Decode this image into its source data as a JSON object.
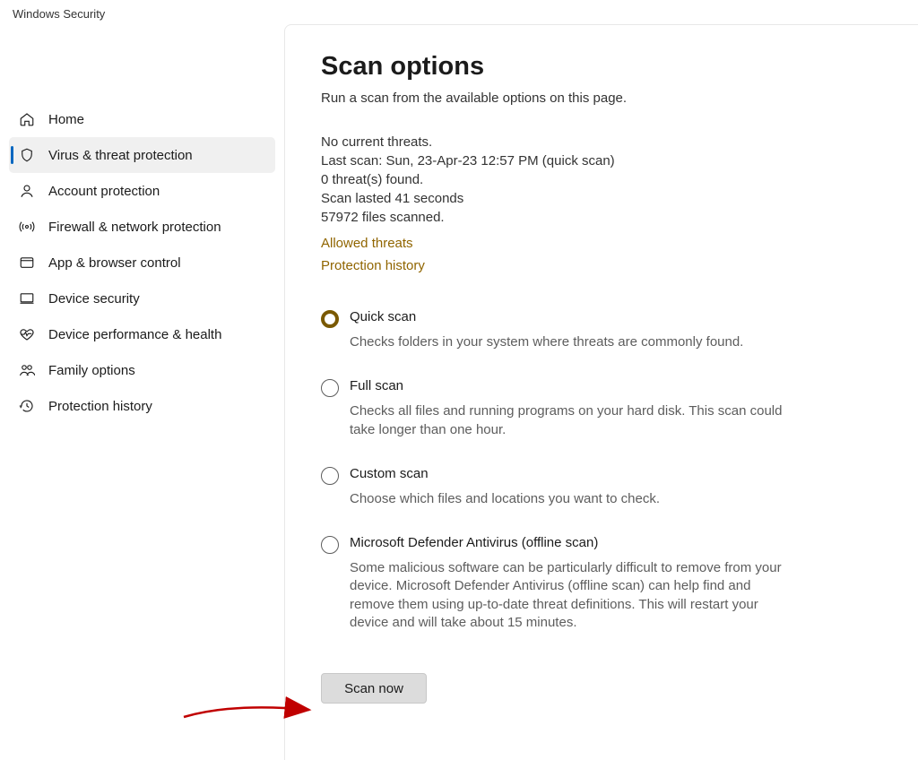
{
  "window": {
    "title": "Windows Security"
  },
  "sidebar": {
    "items": [
      {
        "label": "Home",
        "icon": "home-icon"
      },
      {
        "label": "Virus & threat protection",
        "icon": "shield-icon",
        "selected": true
      },
      {
        "label": "Account protection",
        "icon": "person-icon"
      },
      {
        "label": "Firewall & network protection",
        "icon": "antenna-icon"
      },
      {
        "label": "App & browser control",
        "icon": "browser-icon"
      },
      {
        "label": "Device security",
        "icon": "device-icon"
      },
      {
        "label": "Device performance & health",
        "icon": "heart-icon"
      },
      {
        "label": "Family options",
        "icon": "family-icon"
      },
      {
        "label": "Protection history",
        "icon": "history-icon"
      }
    ]
  },
  "main": {
    "title": "Scan options",
    "subtitle": "Run a scan from the available options on this page.",
    "status": {
      "threats": "No current threats.",
      "last_scan": "Last scan: Sun, 23-Apr-23 12:57 PM (quick scan)",
      "found": "0 threat(s) found.",
      "duration": "Scan lasted 41 seconds",
      "files": "57972 files scanned."
    },
    "links": {
      "allowed": "Allowed threats",
      "history": "Protection history"
    },
    "options": [
      {
        "key": "quick",
        "title": "Quick scan",
        "desc": "Checks folders in your system where threats are commonly found.",
        "checked": true
      },
      {
        "key": "full",
        "title": "Full scan",
        "desc": "Checks all files and running programs on your hard disk. This scan could take longer than one hour.",
        "checked": false
      },
      {
        "key": "custom",
        "title": "Custom scan",
        "desc": "Choose which files and locations you want to check.",
        "checked": false
      },
      {
        "key": "offline",
        "title": "Microsoft Defender Antivirus (offline scan)",
        "desc": "Some malicious software can be particularly difficult to remove from your device. Microsoft Defender Antivirus (offline scan) can help find and remove them using up-to-date threat definitions. This will restart your device and will take about 15 minutes.",
        "checked": false
      }
    ],
    "scan_button": "Scan now"
  },
  "annotation": {
    "color": "#c00000"
  }
}
